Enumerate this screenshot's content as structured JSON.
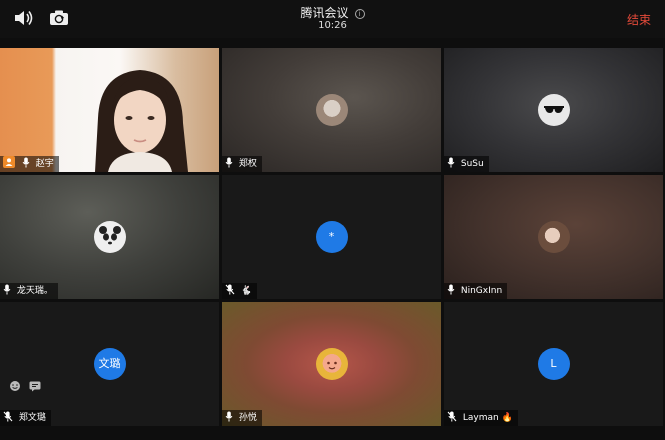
{
  "window": {
    "title": "腾讯会议",
    "time": "10:26",
    "end_label": "结束",
    "info_glyph": "i"
  },
  "colors": {
    "end": "#e44a3a",
    "active_border": "#3ea86d",
    "avatar_blue": "#1f7ae6"
  },
  "participants": [
    {
      "name": "赵宇",
      "icons": [
        "person-icon",
        "mic-icon"
      ],
      "video": true
    },
    {
      "name": "郑权",
      "icons": [
        "mic-icon"
      ],
      "avatar": "photo"
    },
    {
      "name": "SuSu",
      "icons": [
        "mic-icon"
      ],
      "avatar": "sunglasses"
    },
    {
      "name": "龙天瑞。",
      "icons": [
        "mic-icon"
      ],
      "avatar": "panda"
    },
    {
      "name": "🐇",
      "icons": [
        "mic-muted-icon"
      ],
      "avatar": "blue-dot",
      "avatar_text": "*"
    },
    {
      "name": "NinGxInn",
      "icons": [
        "mic-icon"
      ],
      "avatar": "photo",
      "active": true
    },
    {
      "name": "郑文璐",
      "icons": [
        "mic-muted-icon"
      ],
      "avatar": "text",
      "avatar_text": "文璐"
    },
    {
      "name": "孙悦",
      "icons": [
        "mic-icon"
      ],
      "avatar": "cartoon"
    },
    {
      "name": "Layman",
      "icons": [
        "mic-muted-icon"
      ],
      "avatar": "text",
      "avatar_text": "L",
      "suffix": "🔥"
    }
  ]
}
